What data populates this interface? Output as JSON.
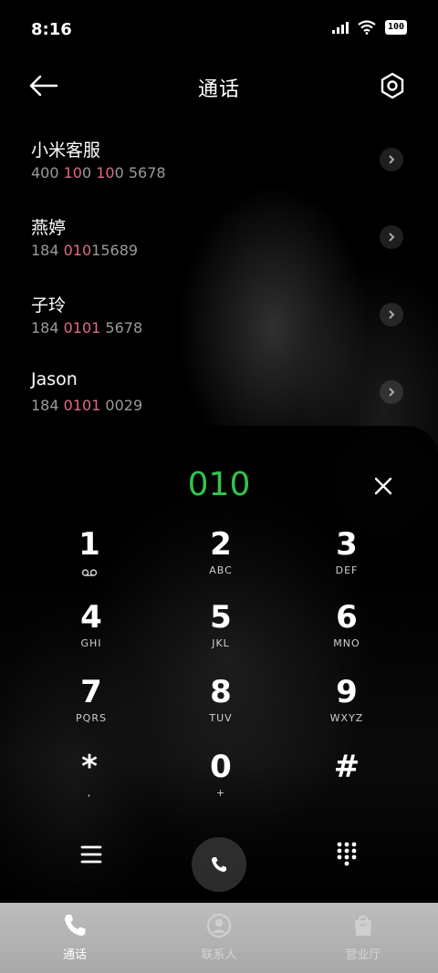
{
  "status_bar": {
    "time": "8:16",
    "battery": "100"
  },
  "header": {
    "title": "通话"
  },
  "contacts": [
    {
      "name": "小米客服",
      "number_parts": [
        "400 ",
        "10",
        "0 ",
        "10",
        "0 5678"
      ]
    },
    {
      "name": "燕婷",
      "number_parts": [
        "184 ",
        "010",
        "15689"
      ]
    },
    {
      "name": "子玲",
      "number_parts": [
        "184 ",
        "0101",
        " 5678"
      ]
    },
    {
      "name": "Jason",
      "number_parts": [
        "184 ",
        "0101",
        " 0029"
      ]
    }
  ],
  "dialer": {
    "input": "010",
    "keys": [
      {
        "digit": "1",
        "letters": ""
      },
      {
        "digit": "2",
        "letters": "ABC"
      },
      {
        "digit": "3",
        "letters": "DEF"
      },
      {
        "digit": "4",
        "letters": "GHI"
      },
      {
        "digit": "5",
        "letters": "JKL"
      },
      {
        "digit": "6",
        "letters": "MNO"
      },
      {
        "digit": "7",
        "letters": "PQRS"
      },
      {
        "digit": "8",
        "letters": "TUV"
      },
      {
        "digit": "9",
        "letters": "WXYZ"
      },
      {
        "digit": "*",
        "letters": ","
      },
      {
        "digit": "0",
        "letters": "+"
      },
      {
        "digit": "#",
        "letters": ""
      }
    ]
  },
  "tabs": [
    {
      "label": "通话",
      "icon": "phone-icon"
    },
    {
      "label": "联系人",
      "icon": "person-icon"
    },
    {
      "label": "营业厅",
      "icon": "bag-icon"
    }
  ],
  "colors": {
    "dial_input": "#33c24d",
    "match_highlight": "#e06a88"
  }
}
